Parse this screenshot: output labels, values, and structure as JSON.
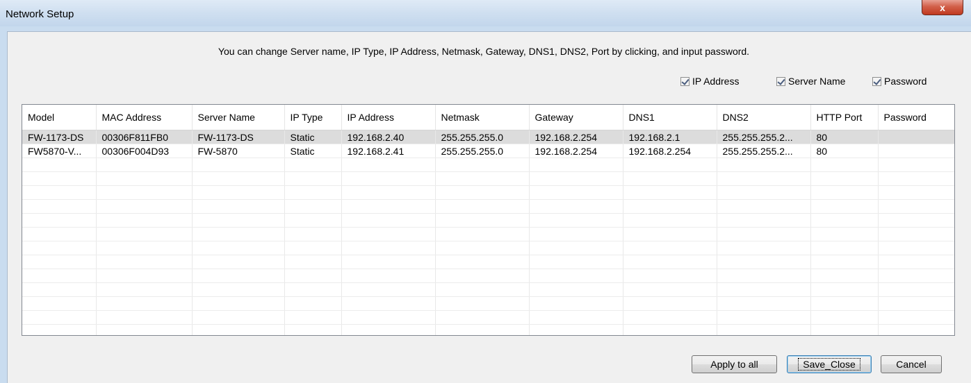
{
  "window": {
    "title": "Network Setup",
    "close_glyph": "x"
  },
  "instructions": "You can change Server name, IP Type, IP Address, Netmask, Gateway, DNS1, DNS2, Port by clicking, and input password.",
  "checkboxes": [
    {
      "label": "IP Address",
      "checked": true
    },
    {
      "label": "Server Name",
      "checked": true
    },
    {
      "label": "Password",
      "checked": true
    }
  ],
  "table": {
    "columns": [
      "Model",
      "MAC Address",
      "Server Name",
      "IP Type",
      "IP Address",
      "Netmask",
      "Gateway",
      "DNS1",
      "DNS2",
      "HTTP Port",
      "Password"
    ],
    "rows": [
      [
        "FW-1173-DS",
        "00306F811FB0",
        "FW-1173-DS",
        "Static",
        "192.168.2.40",
        "255.255.255.0",
        "192.168.2.254",
        "192.168.2.1",
        "255.255.255.2...",
        "80",
        ""
      ],
      [
        "FW5870-V...",
        "00306F004D93",
        "FW-5870",
        "Static",
        "192.168.2.41",
        "255.255.255.0",
        "192.168.2.254",
        "192.168.2.254",
        "255.255.255.2...",
        "80",
        ""
      ]
    ],
    "selected_row": 0
  },
  "buttons": {
    "apply_all": "Apply to all",
    "save_close": "Save_Close",
    "cancel": "Cancel"
  }
}
